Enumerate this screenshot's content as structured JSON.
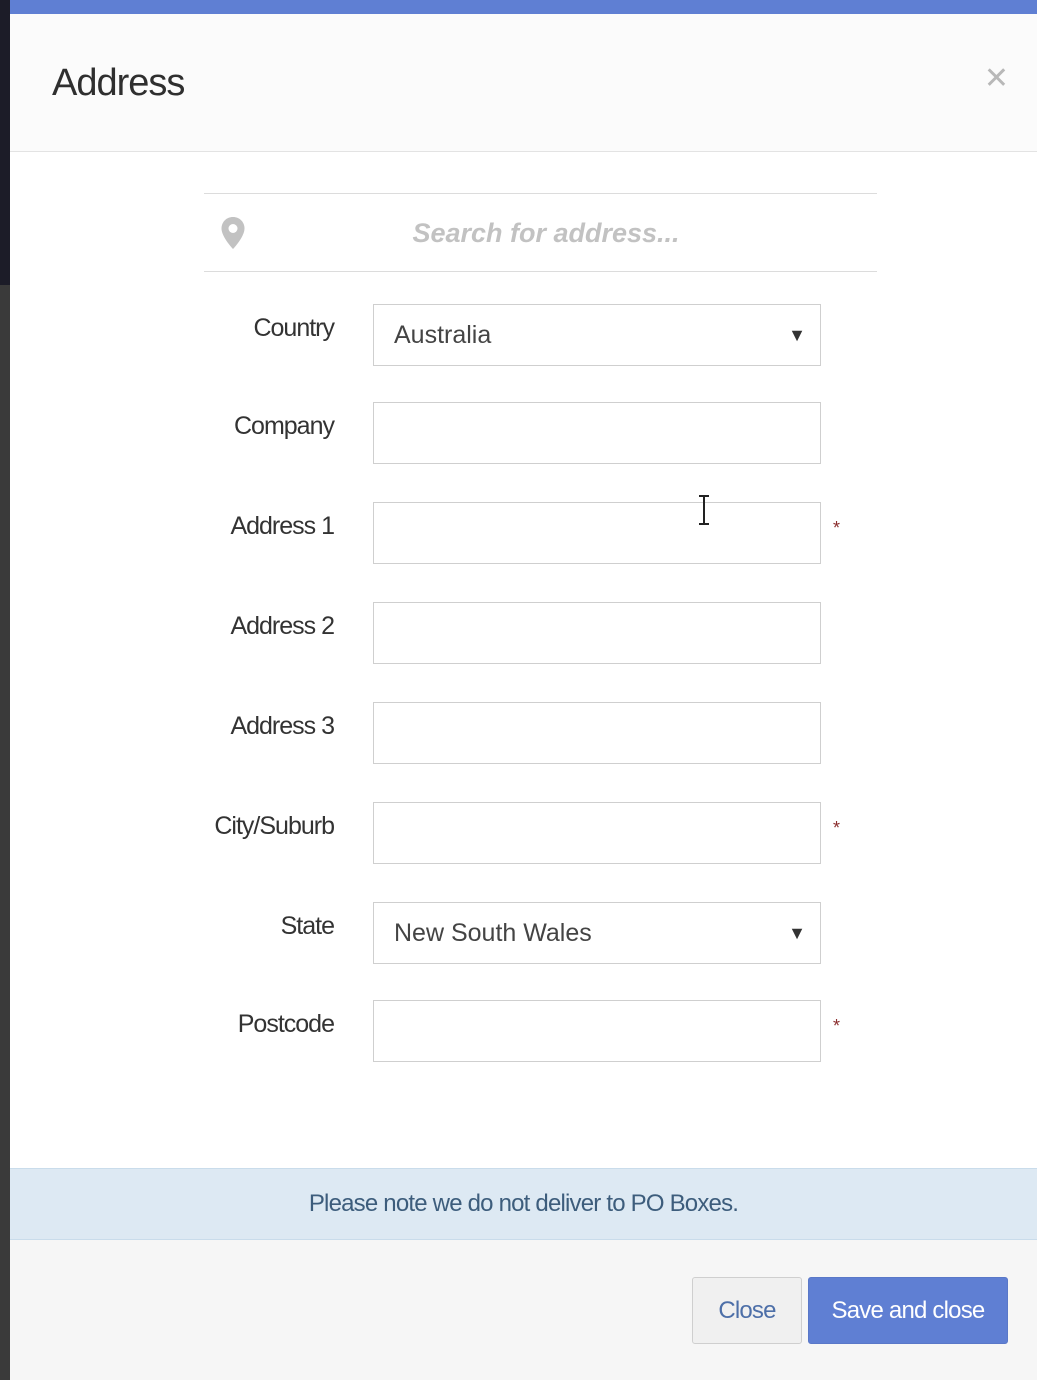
{
  "modal": {
    "title": "Address",
    "close_icon": "close-icon",
    "accent_color": "#5f7fd3"
  },
  "search": {
    "placeholder": "Search for address...",
    "icon": "map-pin-icon"
  },
  "fields": {
    "country": {
      "label": "Country",
      "value": "Australia",
      "required": false
    },
    "company": {
      "label": "Company",
      "value": "",
      "required": false
    },
    "address1": {
      "label": "Address 1",
      "value": "",
      "required": true
    },
    "address2": {
      "label": "Address 2",
      "value": "",
      "required": false
    },
    "address3": {
      "label": "Address 3",
      "value": "",
      "required": false
    },
    "city": {
      "label": "City/Suburb",
      "value": "",
      "required": true
    },
    "state": {
      "label": "State",
      "value": "New South Wales",
      "required": false
    },
    "postcode": {
      "label": "Postcode",
      "value": "",
      "required": true
    }
  },
  "required_marker": "*",
  "select_caret": "▼",
  "notice": {
    "text": "Please note we do not deliver to PO Boxes."
  },
  "footer": {
    "close_label": "Close",
    "save_label": "Save and close"
  }
}
